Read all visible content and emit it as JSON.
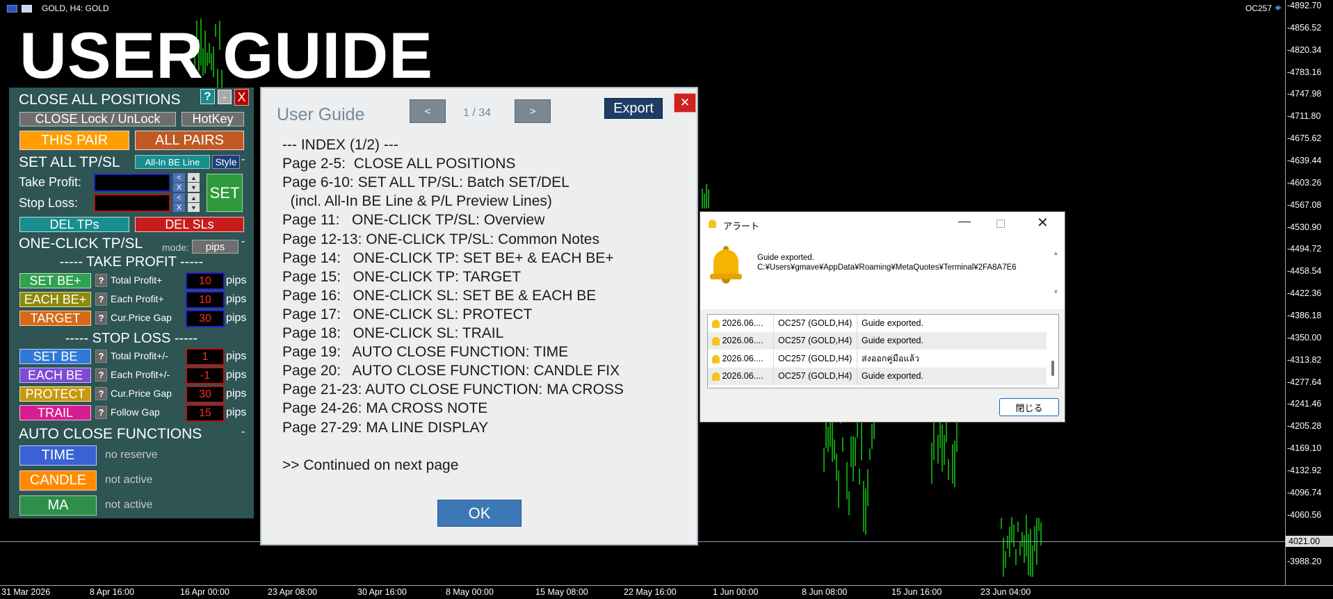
{
  "chart": {
    "symbol_label": "GOLD, H4:  GOLD",
    "indicator_label": "OC257",
    "title": "USER GUIDE",
    "price_labels": [
      "4892.70",
      "4856.52",
      "4820.34",
      "4783.16",
      "4747.98",
      "4711.80",
      "4675.62",
      "4639.44",
      "4603.26",
      "4567.08",
      "4530.90",
      "4494.72",
      "4458.54",
      "4422.36",
      "4386.18",
      "4350.00",
      "4313.82",
      "4277.64",
      "4241.46",
      "4205.28",
      "4169.10",
      "4132.92",
      "4096.74",
      "4060.56",
      "4021.00",
      "3988.20"
    ],
    "current_price": "4021.00",
    "time_labels": [
      "31 Mar 2026",
      "8 Apr 16:00",
      "16 Apr 00:00",
      "23 Apr 08:00",
      "30 Apr 16:00",
      "8 May 00:00",
      "15 May 08:00",
      "22 May 16:00",
      "1 Jun 00:00",
      "8 Jun 08:00",
      "15 Jun 16:00",
      "23 Jun 04:00"
    ],
    "colors": {
      "candle": "#1bff1b",
      "background": "#000000"
    }
  },
  "panel": {
    "close_all_title": "CLOSE ALL POSITIONS",
    "help_btn": "?",
    "min_btn": "-",
    "close_btn": "X",
    "close_lock": "CLOSE Lock / UnLock",
    "hotkey": "HotKey",
    "this_pair": "THIS PAIR",
    "all_pairs": "ALL PAIRS",
    "set_all_title": "SET ALL TP/SL",
    "allin_be": "All-In BE Line",
    "style": "Style",
    "dash": "-",
    "take_profit": "Take Profit:",
    "stop_loss": "Stop Loss:",
    "lt": "<",
    "x": "X",
    "up": "▲",
    "down": "▼",
    "set": "SET",
    "del_tps": "DEL TPs",
    "del_sls": "DEL SLs",
    "one_click_title": "ONE-CLICK TP/SL",
    "mode_label": "mode:",
    "mode_value": "pips",
    "tp_header": "----- TAKE PROFIT -----",
    "sl_header": "----- STOP LOSS -----",
    "pips": "pips",
    "q": "?",
    "tp_rows": [
      {
        "button": "SET BE+",
        "label": "Total Profit+",
        "value": "10"
      },
      {
        "button": "EACH BE+",
        "label": "Each Profit+",
        "value": "10"
      },
      {
        "button": "TARGET",
        "label": "Cur.Price Gap",
        "value": "30"
      }
    ],
    "sl_rows": [
      {
        "button": "SET BE",
        "label": "Total Profit+/-",
        "value": "1"
      },
      {
        "button": "EACH BE",
        "label": "Each Profit+/-",
        "value": "-1"
      },
      {
        "button": "PROTECT",
        "label": "Cur.Price Gap",
        "value": "30"
      },
      {
        "button": "TRAIL",
        "label": "Follow Gap",
        "value": "15"
      }
    ],
    "auto_title": "AUTO CLOSE FUNCTIONS",
    "auto_rows": [
      {
        "button": "TIME",
        "status": "no reserve"
      },
      {
        "button": "CANDLE",
        "status": "not active"
      },
      {
        "button": "MA",
        "status": "not active"
      }
    ],
    "colors": {
      "bg": "#2e5454",
      "title_pink": "#ffa5a5",
      "header_blue": "#8fd1ff"
    }
  },
  "guide": {
    "title": "User Guide",
    "prev": "<",
    "next": ">",
    "page": "1 / 34",
    "export": "Export",
    "close": "✕",
    "lines": [
      "--- INDEX (1/2) ---",
      "Page 2-5:  CLOSE ALL POSITIONS",
      "Page 6-10: SET ALL TP/SL: Batch SET/DEL",
      "  (incl. All-In BE Line & P/L Preview Lines)",
      "Page 11:   ONE-CLICK TP/SL: Overview",
      "Page 12-13: ONE-CLICK TP/SL: Common Notes",
      "Page 14:   ONE-CLICK TP: SET BE+ & EACH BE+",
      "Page 15:   ONE-CLICK TP: TARGET",
      "Page 16:   ONE-CLICK SL: SET BE & EACH BE",
      "Page 17:   ONE-CLICK SL: PROTECT",
      "Page 18:   ONE-CLICK SL: TRAIL",
      "Page 19:   AUTO CLOSE FUNCTION: TIME",
      "Page 20:   AUTO CLOSE FUNCTION: CANDLE FIX",
      "Page 21-23: AUTO CLOSE FUNCTION: MA CROSS",
      "Page 24-26: MA CROSS NOTE",
      "Page 27-29: MA LINE DISPLAY",
      "",
      ">> Continued on next page"
    ],
    "ok": "OK"
  },
  "alert": {
    "title": "アラート",
    "message_line1": "Guide exported.",
    "message_line2": "C:¥Users¥gmave¥AppData¥Roaming¥MetaQuotes¥Terminal¥2FA8A7E6",
    "rows": [
      {
        "time": "2026.06....",
        "source": "OC257 (GOLD,H4)",
        "message": "Guide exported."
      },
      {
        "time": "2026.06....",
        "source": "OC257 (GOLD,H4)",
        "message": "Guide exported."
      },
      {
        "time": "2026.06....",
        "source": "OC257 (GOLD,H4)",
        "message": "ส่งออกคู่มือแล้ว"
      },
      {
        "time": "2026.06....",
        "source": "OC257 (GOLD,H4)",
        "message": "Guide exported."
      }
    ],
    "close_button": "閉じる"
  }
}
